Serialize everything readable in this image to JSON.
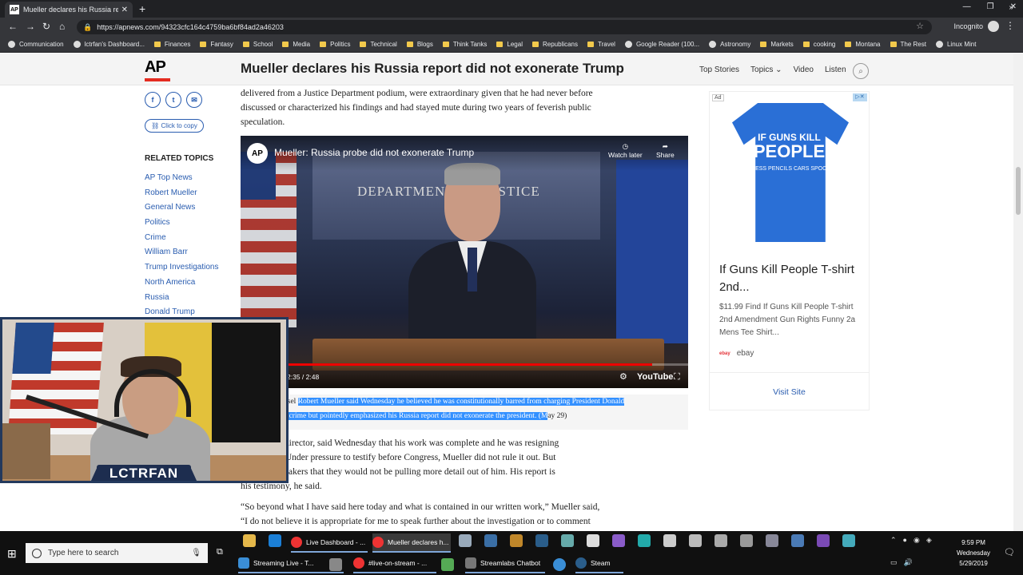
{
  "browser": {
    "tab_title": "Mueller declares his Russia report",
    "tab_favicon": "AP",
    "url": "https://apnews.com/94323cfc164c4759ba6bf84ad2a46203",
    "profile": "Incognito",
    "bookmarks": [
      "Communication",
      "lctrfan's Dashboard...",
      "Finances",
      "Fantasy",
      "School",
      "Media",
      "Politics",
      "Technical",
      "Blogs",
      "Think Tanks",
      "Legal",
      "Republicans",
      "Travel",
      "Google Reader (100...",
      "Astronomy",
      "Markets",
      "cooking",
      "Montana",
      "The Rest",
      "Linux Mint"
    ]
  },
  "header": {
    "logo": "AP",
    "headline": "Mueller declares his Russia report did not exonerate Trump",
    "nav": [
      "Top Stories",
      "Topics",
      "Video",
      "Listen"
    ]
  },
  "sidebar": {
    "share_icons": [
      "f",
      "t",
      "✉"
    ],
    "copy_label": "Click to copy",
    "related_heading": "RELATED TOPICS",
    "related": [
      "AP Top News",
      "Robert Mueller",
      "General News",
      "Politics",
      "Crime",
      "William Barr",
      "Trump Investigations",
      "North America",
      "Russia",
      "Donald Trump"
    ]
  },
  "article": {
    "para_top_1": "delivered from a Justice Department podium, were extraordinary given that he had never before",
    "para_top_2": "discussed or characterized his findings and had stayed mute during two years of feverish public",
    "para_top_3": "speculation.",
    "caption_prefix": "nsel ",
    "caption_hl_1": "Robert Mueller said Wednesday he believed he was constitutionally barred from charging President Donald",
    "caption_hl_2": "a crime but pointedly emphasized his Russia report did not exonerate the president. (M",
    "caption_suffix": "ay 29)",
    "para_mid_1": "former FBI director, said Wednesday that his work was complete and he was resigning",
    "para_mid_2": "private life. Under pressure to testify before Congress, Mueller did not rule it out. But",
    "para_mid_3": "o warn lawmakers that they would not be pulling more detail out of him. His report is",
    "para_mid_4": "his testimony, he said.",
    "para_bot_1": "“So beyond what I have said here today and what is contained in our written work,” Mueller said,",
    "para_bot_2": "“I do not believe it is appropriate for me to speak further about the investigation or to comment"
  },
  "video": {
    "logo": "AP",
    "title": "Mueller: Russia probe did not exonerate Trump",
    "watch_later": "Watch later",
    "share": "Share",
    "sign": "DEPARTMENT OF JUSTICE",
    "time": "2:35 / 2:48",
    "progress": 0.92,
    "youtube": "YouTube"
  },
  "ad": {
    "tag": "Ad",
    "shirt_line1": "IF GUNS KILL",
    "shirt_line2": "PEOPLE",
    "shirt_line3": "I GUESS PENCILS CARS SPOONS",
    "title": "If Guns Kill People T-shirt 2nd...",
    "description": "$11.99 Find If Guns Kill People T-shirt 2nd Amendment Gun Rights Funny 2a Mens Tee Shirt...",
    "source": "ebay",
    "visit": "Visit Site"
  },
  "webcam": {
    "label": "LCTRFAN"
  },
  "taskbar": {
    "search_placeholder": "Type here to search",
    "items": [
      "Live Dashboard - ...",
      "Mueller declares h...",
      "Streaming Live - T...",
      "#live-on-stream - ...",
      "Streamlabs Chatbot",
      "Steam"
    ],
    "time": "9:59 PM",
    "day": "Wednesday",
    "date": "5/29/2019"
  }
}
